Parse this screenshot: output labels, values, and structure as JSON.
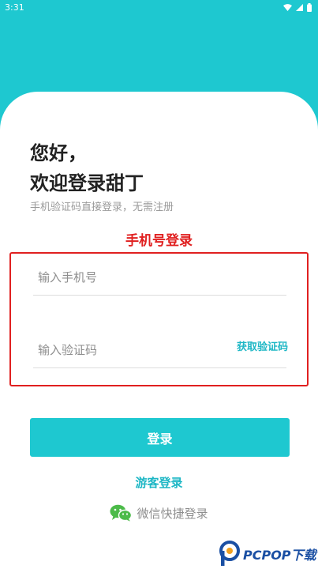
{
  "status_bar": {
    "time": "3:31",
    "icons": [
      "wifi-icon",
      "signal-icon",
      "battery-icon"
    ]
  },
  "colors": {
    "accent": "#1ec8d0",
    "link": "#1eb7c5",
    "annotation": "#e02020",
    "wechat_green": "#4cbb49"
  },
  "greeting": {
    "line1": "您好，",
    "line2": "欢迎登录甜丁",
    "subtitle": "手机验证码直接登录，无需注册"
  },
  "annotation": {
    "title": "手机号登录"
  },
  "form": {
    "phone_placeholder": "输入手机号",
    "phone_value": "",
    "code_placeholder": "输入验证码",
    "code_value": "",
    "get_code_label": "获取验证码"
  },
  "actions": {
    "login_label": "登录",
    "guest_login_label": "游客登录",
    "wechat_login_label": "微信快捷登录"
  },
  "watermark": {
    "text": "PCPOP下载"
  }
}
